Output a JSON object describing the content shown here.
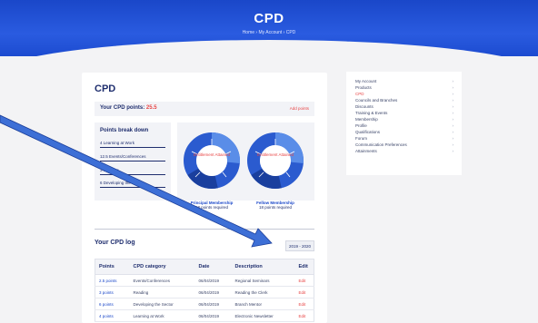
{
  "header": {
    "title": "CPD",
    "breadcrumb": "Home › My Account › CPD"
  },
  "main": {
    "title": "CPD",
    "points_label": "Your CPD points:",
    "points_value": "25.5",
    "add_points": "Add points",
    "breakdown": {
      "title": "Points break down",
      "items": [
        "4 Learning at Work",
        "12.5 Events/Conferences",
        "3 Reading",
        "6 Developing the Sector"
      ]
    },
    "donuts": [
      {
        "center": "Entitlement Attained",
        "name": "Principal Membership",
        "req": "18 points required"
      },
      {
        "center": "Entitlement Attained",
        "name": "Fellow Membership",
        "req": "18 points required"
      }
    ],
    "log": {
      "title": "Your CPD log",
      "year": "2019 - 2020",
      "columns": [
        "Points",
        "CPD category",
        "Date",
        "Description",
        "Edit"
      ],
      "rows": [
        [
          "2.5 points",
          "Events/Conferences",
          "06/04/2019",
          "Regional Seminars",
          "Edit"
        ],
        [
          "3 points",
          "Reading",
          "06/04/2019",
          "Reading the Clerk",
          "Edit"
        ],
        [
          "6 points",
          "Developing the Sector",
          "06/04/2019",
          "Branch Mentor",
          "Edit"
        ],
        [
          "4 points",
          "Learning at Work",
          "06/04/2019",
          "Electronic Newsletter",
          "Edit"
        ]
      ]
    }
  },
  "sidebar": {
    "items": [
      {
        "label": "My Account",
        "active": false
      },
      {
        "label": "Products",
        "active": false
      },
      {
        "label": "CPD",
        "active": true
      },
      {
        "label": "Councils and Branches",
        "active": false
      },
      {
        "label": "Discounts",
        "active": false
      },
      {
        "label": "Training & Events",
        "active": false
      },
      {
        "label": "Membership",
        "active": false
      },
      {
        "label": "Profile",
        "active": false
      },
      {
        "label": "Qualifications",
        "active": false
      },
      {
        "label": "Forum",
        "active": false
      },
      {
        "label": "Communication Preferences",
        "active": false
      },
      {
        "label": "Attainments",
        "active": false
      }
    ],
    "chevron": "›"
  },
  "colors": {
    "brand": "#1a47c9",
    "accent": "#e84545",
    "arrow": "#3d6fd6"
  }
}
